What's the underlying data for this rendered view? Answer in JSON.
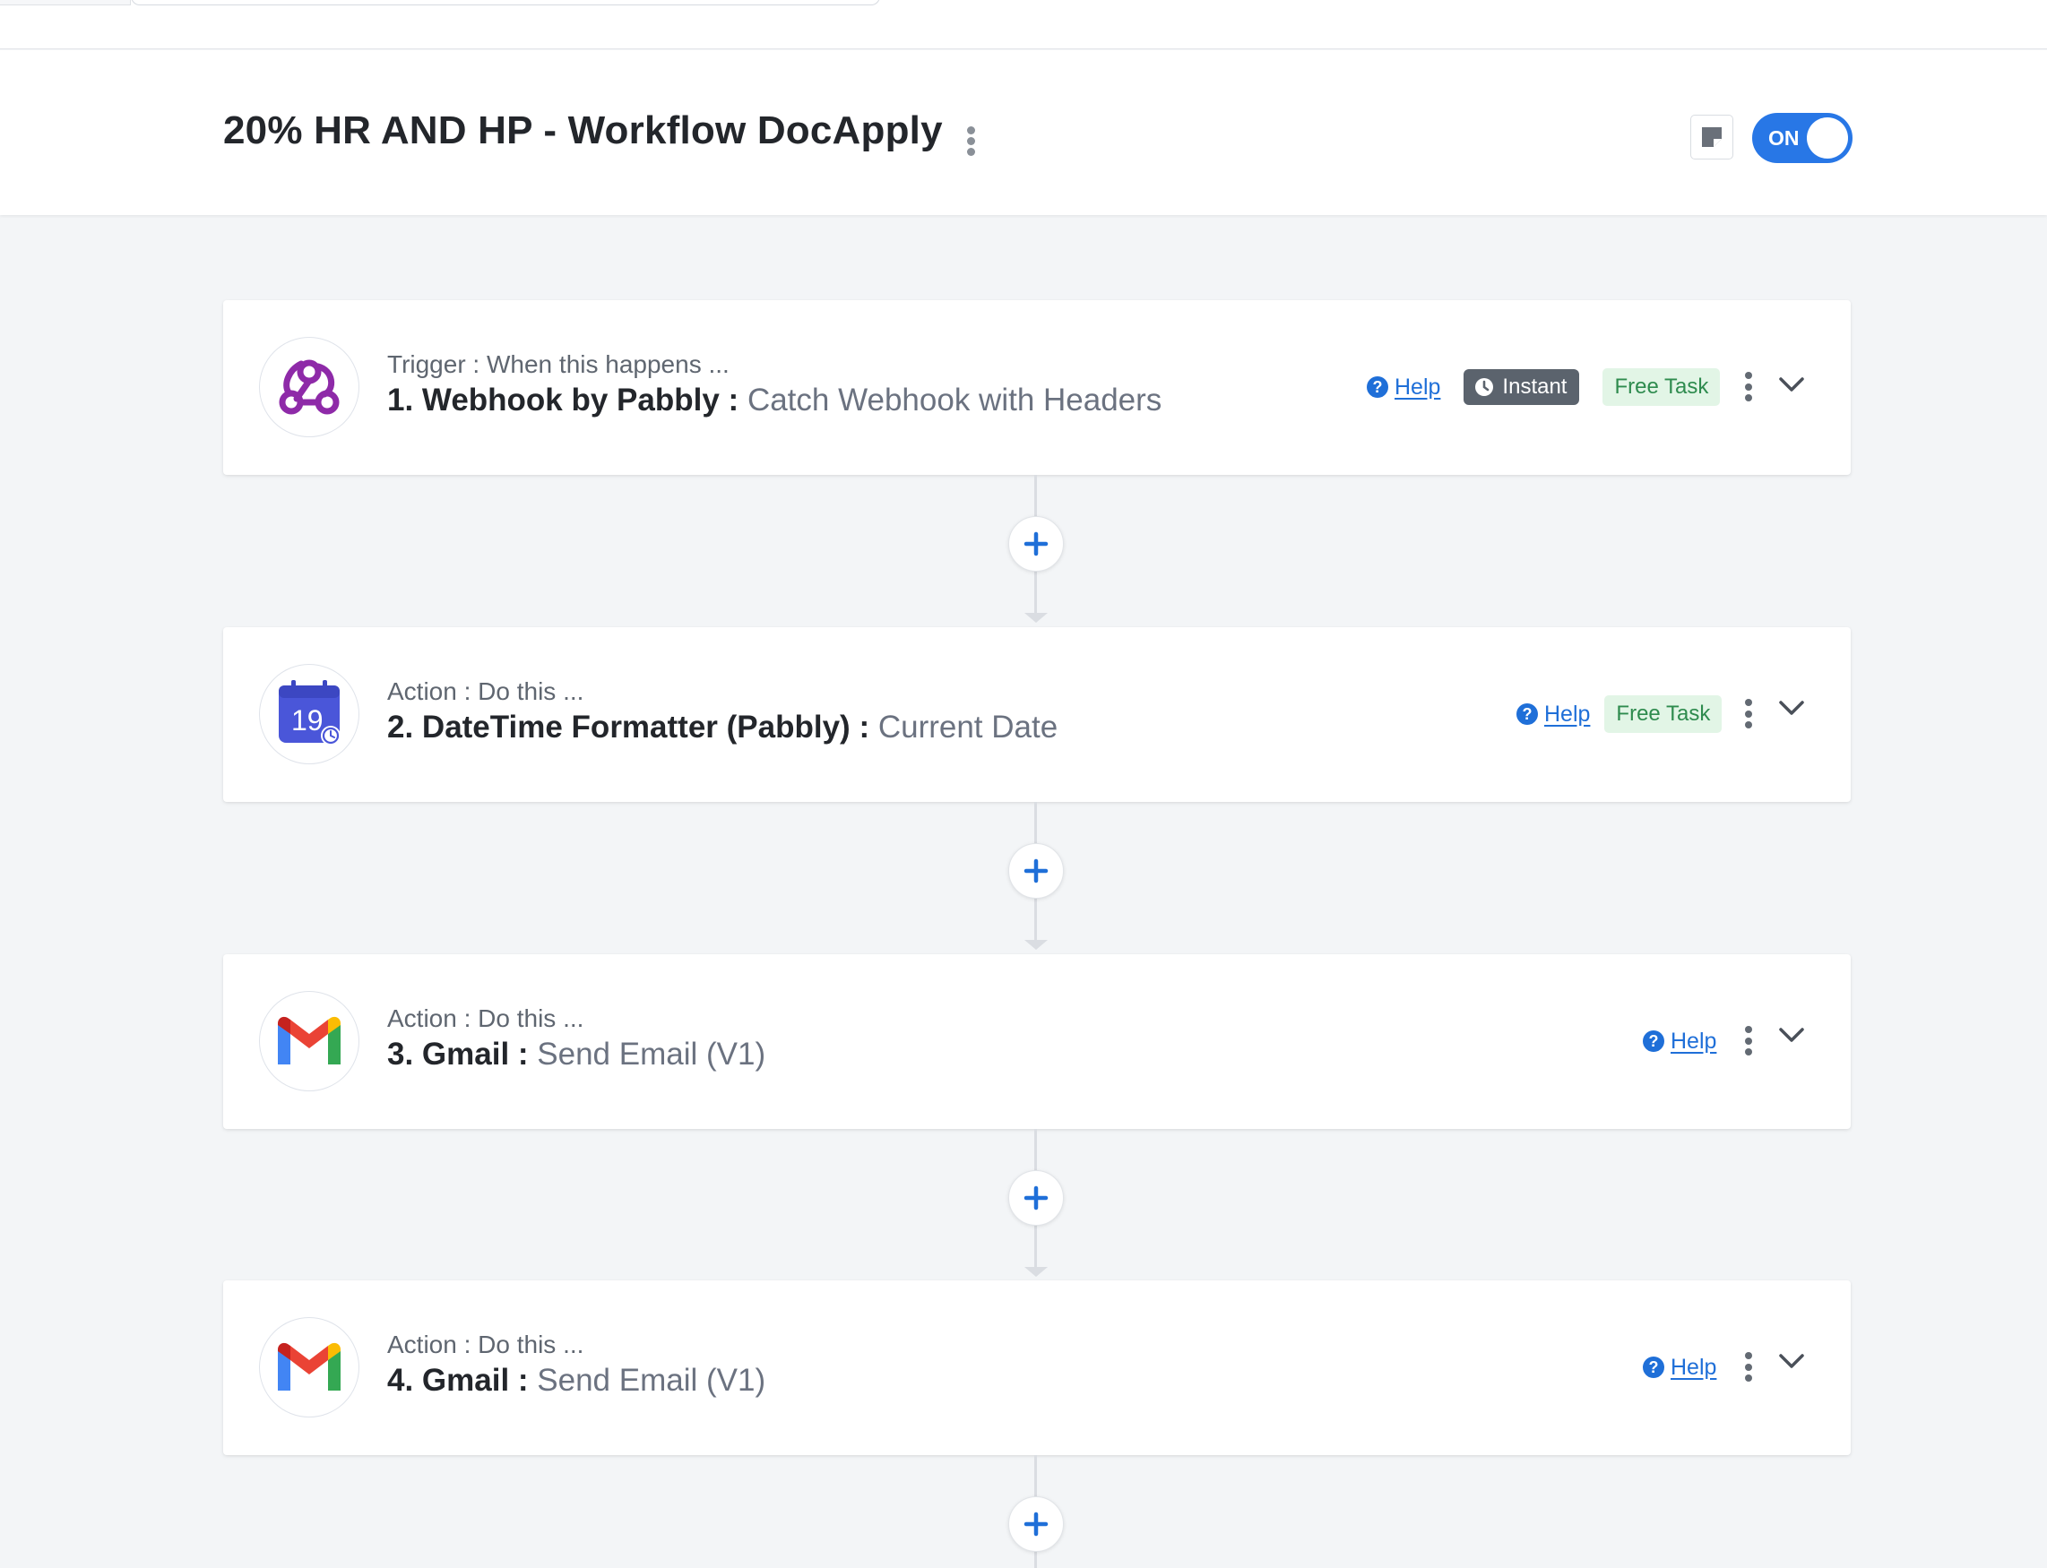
{
  "workflow": {
    "title": "20% HR AND HP - Workflow DocApply",
    "status_toggle_label": "ON"
  },
  "steps": [
    {
      "kind": "Trigger : When this happens ...",
      "app": "1. Webhook by Pabbly",
      "separator": " : ",
      "event": "Catch Webhook with Headers",
      "icon": "webhook-icon",
      "help": "Help",
      "badges": [
        "Instant",
        "Free Task"
      ]
    },
    {
      "kind": "Action : Do this ...",
      "app": "2. DateTime Formatter (Pabbly)",
      "separator": " : ",
      "event": "Current Date",
      "icon": "calendar-icon",
      "icon_text": "19",
      "help": "Help",
      "badges": [
        "Free Task"
      ]
    },
    {
      "kind": "Action : Do this ...",
      "app": "3. Gmail",
      "separator": " : ",
      "event": "Send Email (V1)",
      "icon": "gmail-icon",
      "help": "Help",
      "badges": []
    },
    {
      "kind": "Action : Do this ...",
      "app": "4. Gmail",
      "separator": " : ",
      "event": "Send Email (V1)",
      "icon": "gmail-icon",
      "help": "Help",
      "badges": []
    }
  ],
  "colors": {
    "accent": "#2877e6",
    "link": "#1f6fd8",
    "free_task_bg": "#e2f5e6",
    "free_task_text": "#2e8b4e",
    "instant_bg": "#5b636d",
    "webhook_purple": "#8e2aa8",
    "calendar_blue": "#4a56d9"
  }
}
